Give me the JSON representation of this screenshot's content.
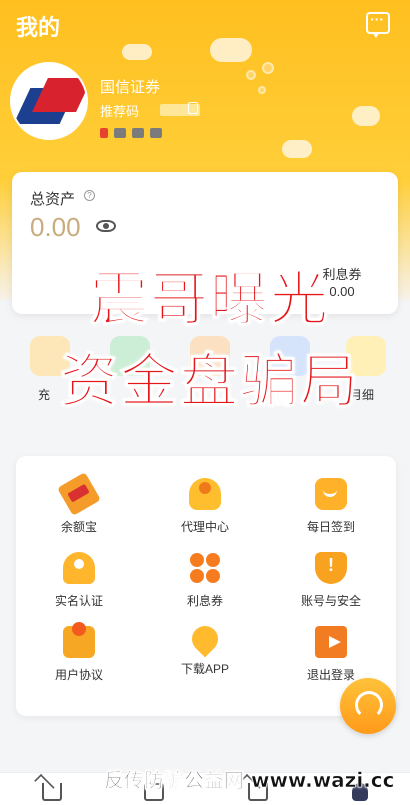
{
  "header": {
    "title": "我的"
  },
  "profile": {
    "company": "国信证券",
    "referral_prefix": "推荐码"
  },
  "assets": {
    "label": "总资产",
    "value": "0.00",
    "coupon_label": "利息券",
    "coupon_value": "0.00"
  },
  "quick_actions": {
    "left_label": "充",
    "right_label": "月细"
  },
  "menu": {
    "items": [
      {
        "label": "余额宝",
        "icon": "tag-icon"
      },
      {
        "label": "代理中心",
        "icon": "agent-icon"
      },
      {
        "label": "每日签到",
        "icon": "sign-icon"
      },
      {
        "label": "实名认证",
        "icon": "id-icon"
      },
      {
        "label": "利息券",
        "icon": "coupon-icon"
      },
      {
        "label": "账号与安全",
        "icon": "shield-icon"
      },
      {
        "label": "用户协议",
        "icon": "doc-icon"
      },
      {
        "label": "下载APP",
        "icon": "download-icon"
      },
      {
        "label": "退出登录",
        "icon": "logout-icon"
      }
    ]
  },
  "overlay": {
    "line1": "震哥曝光",
    "line2": "资金盘骗局",
    "footer": "反传防骗公益网 www.wazi.cc"
  },
  "colors": {
    "brand_yellow": "#ffbf1f",
    "asset_value": "#c9ab7d",
    "watermark_red": "#e4161a"
  }
}
